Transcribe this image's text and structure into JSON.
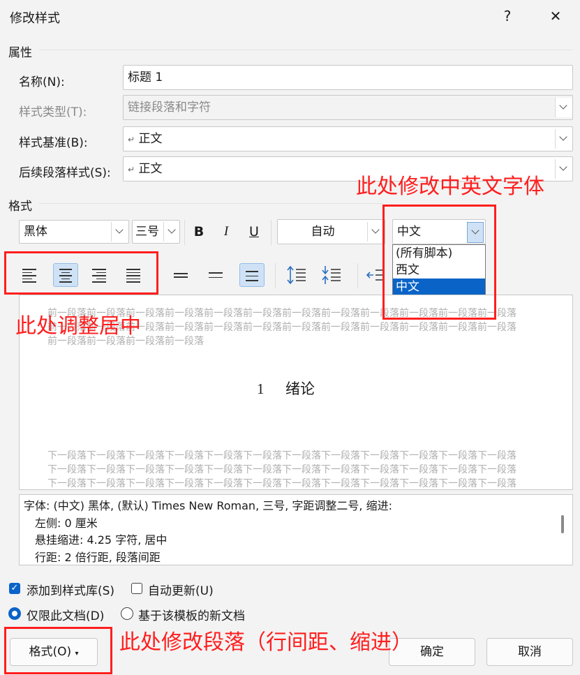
{
  "window": {
    "title": "修改样式",
    "help_label": "?",
    "close_label": "✕"
  },
  "properties": {
    "section_label": "属性",
    "name_label": "名称(N):",
    "name_value": "标题 1",
    "type_label": "样式类型(T):",
    "type_value": "链接段落和字符",
    "based_on_label": "样式基准(B):",
    "based_on_value": "正文",
    "next_label": "后续段落样式(S):",
    "next_value": "正文",
    "para_mark": "↵"
  },
  "format": {
    "section_label": "格式",
    "font": "黑体",
    "size": "三号",
    "bold": "B",
    "italic": "I",
    "underline": "U",
    "color": "自动",
    "script": "中文"
  },
  "script_options": [
    "(所有脚本)",
    "西文",
    "中文"
  ],
  "preview": {
    "before_text": "前一段落前一段落前一段落前一段落前一段落前一段落前一段落前一段落前一段落前一段落前一段落前一段落前一段落前一段落前一段落前一段落前一段落前一段落前一段落前一段落前一段落前一段落前一段落前一段落前一段落前一段落前一段落前一段落",
    "heading_number": "1",
    "heading_text": "绪论",
    "after_text": "下一段落下一段落下一段落下一段落下一段落下一段落下一段落下一段落下一段落下一段落下一段落下一段落下一段落下一段落下一段落下一段落下一段落下一段落下一段落下一段落下一段落下一段落下一段落下一段落下一段落下一段落下一段落下一段落下一段落下一段落下一段落下一段落下一段落下一段落下一段落下一段落下一段落下一段落下一段落下一段落"
  },
  "description": {
    "line1": "字体: (中文) 黑体, (默认) Times New Roman, 三号, 字距调整二号, 缩进:",
    "line2": "左侧:  0 厘米",
    "line3": "悬挂缩进: 4.25 字符, 居中",
    "line4": "行距: 2 倍行距, 段落间距"
  },
  "options": {
    "add_gallery": "添加到样式库(S)",
    "auto_update": "自动更新(U)",
    "only_doc": "仅限此文档(D)",
    "template": "基于该模板的新文档"
  },
  "buttons": {
    "format": "格式(O)",
    "ok": "确定",
    "cancel": "取消"
  },
  "annotations": {
    "font_note": "此处修改中英文字体",
    "align_note": "此处调整居中",
    "para_note": "此处修改段落（行间距、缩进）"
  },
  "colors": {
    "annotation": "#ff1e1e",
    "selection": "#0a64c8",
    "checkbox": "#0a64c8"
  }
}
